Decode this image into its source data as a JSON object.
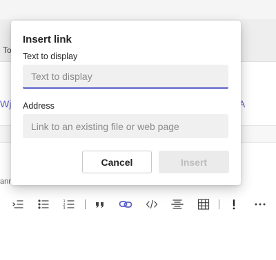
{
  "background": {
    "fragment_to": "To",
    "fragment_link_left": "Wj",
    "fragment_link_right": "A",
    "fragment_bottom": "ann"
  },
  "dialog": {
    "title": "Insert link",
    "display_label": "Text to display",
    "display_value": "",
    "display_placeholder": "Text to display",
    "address_label": "Address",
    "address_value": "",
    "address_placeholder": "Link to an existing file or web page",
    "cancel_label": "Cancel",
    "insert_label": "Insert",
    "accent_color": "#5b5fc7"
  },
  "toolbar": {
    "items": [
      {
        "icon": "decrease-indent-icon"
      },
      {
        "icon": "bulleted-list-icon"
      },
      {
        "icon": "numbered-list-icon"
      },
      {
        "icon": "quote-icon"
      },
      {
        "icon": "link-icon",
        "active": true
      },
      {
        "icon": "code-snippet-icon"
      },
      {
        "icon": "horizontal-rule-icon"
      },
      {
        "icon": "table-icon"
      },
      {
        "icon": "important-icon"
      },
      {
        "icon": "more-options-icon"
      }
    ]
  }
}
